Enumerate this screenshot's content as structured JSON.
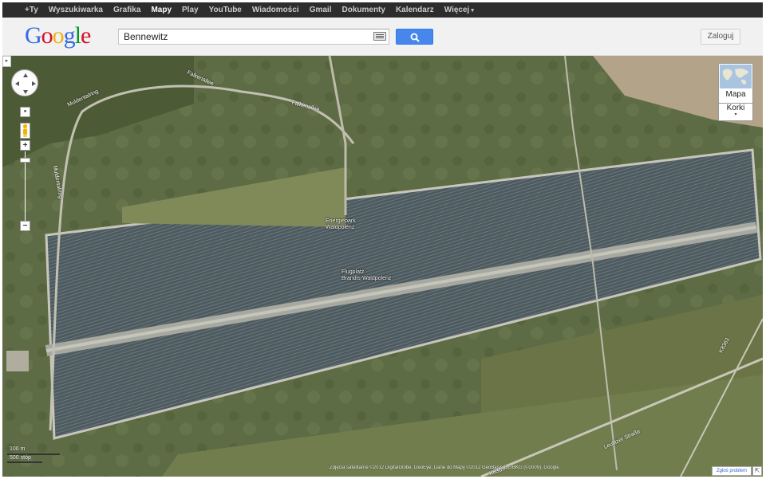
{
  "topbar": {
    "items": [
      "+Ty",
      "Wyszukiwarka",
      "Grafika",
      "Mapy",
      "Play",
      "YouTube",
      "Wiadomości",
      "Gmail",
      "Dokumenty",
      "Kalendarz",
      "Więcej"
    ],
    "active": "Mapy",
    "more_caret": "▾"
  },
  "header": {
    "logo": [
      "G",
      "o",
      "o",
      "g",
      "l",
      "e"
    ],
    "logo_colors": [
      "#3369e8",
      "#d50f25",
      "#eeb211",
      "#3369e8",
      "#009925",
      "#d50f25"
    ],
    "search_value": "Bennewitz",
    "login_label": "Zaloguj"
  },
  "map": {
    "side_tab": "▸",
    "zoom_in": "+",
    "zoom_out": "−",
    "maptype_label": "Mapa",
    "traffic_label": "Korki",
    "traffic_caret": "▾",
    "places": [
      {
        "line1": "Energiepark",
        "line2": "Waldpolenz"
      },
      {
        "line1": "Flugplatz",
        "line2": "Brandis-Waldpolenz"
      }
    ],
    "roads": [
      "Falkenallee",
      "Falkenallee",
      "Muldentalring",
      "Muldentalring",
      "K8363",
      "Leulitzer Straße",
      "K8363"
    ],
    "scale": {
      "top": "100 m",
      "bottom": "500 stóp"
    },
    "attribution": "Zdjęcia satelitarne ©2012 DigitalGlobe, GeoEye, Dane do Mapy ©2012 GeoBasis-DE/BKG (©2009), Google",
    "report_label": "Zgłoś problem",
    "corner_icon": "⇱"
  }
}
